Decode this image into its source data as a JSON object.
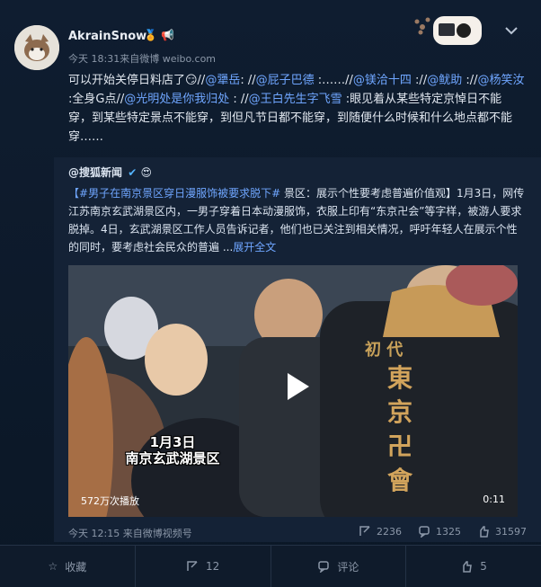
{
  "author": {
    "name": "AkrainSnow",
    "badges": [
      "gold-badge-icon",
      "megaphone-icon"
    ],
    "meta": "今天 18:31来自微博 weibo.com"
  },
  "post": {
    "segments": [
      {
        "text": "可以开始关停日料店了😏//"
      },
      {
        "text": "@犟岳",
        "link": true
      },
      {
        "text": ": //"
      },
      {
        "text": "@屁子巴德",
        "link": true
      },
      {
        "text": " :……//"
      },
      {
        "text": "@镁洽十四",
        "link": true
      },
      {
        "text": " ://"
      },
      {
        "text": "@鱿助",
        "link": true
      },
      {
        "text": " ://"
      },
      {
        "text": "@杨笑汝",
        "link": true
      },
      {
        "text": " :全身G点//"
      },
      {
        "text": "@光明处是你我归处",
        "link": true
      },
      {
        "text": " : //"
      },
      {
        "text": "@王白先生字飞雪",
        "link": true
      },
      {
        "text": " :眼见着从某些特定京悼日不能穿，到某些特定景点不能穿，到但凡节日都不能穿，到随便什么时候和什么地点都不能穿……"
      }
    ]
  },
  "repost": {
    "user": "@搜狐新闻",
    "topic": "#男子在南京景区穿日漫服饰被要求脱下#",
    "body": " 景区：展示个性要考虑普遍价值观】1月3日，网传江苏南京玄武湖景区内，一男子穿着日本动漫服饰，衣服上印有“东京卍会”等字样，被游人要求脱掉。4日，玄武湖景区工作人员告诉记者，他们也已关注到相关情况，呼吁年轻人在展示个性的同时，要考虑社会民众的普遍 ...",
    "expand": "展开全文",
    "video": {
      "caption_line1": "1月3日",
      "caption_line2": "南京玄武湖景区",
      "jacket_top": "初 代",
      "jacket_chars": [
        "東",
        "京",
        "卍",
        "會"
      ],
      "plays": "572万次播放",
      "duration": "0:11"
    },
    "meta": "今天 12:15 来自微博视频号",
    "stats": {
      "reposts": "2236",
      "comments": "1325",
      "likes": "31597"
    }
  },
  "actions": {
    "favorite": "收藏",
    "repost": "12",
    "comment": "评论",
    "like": "5"
  }
}
